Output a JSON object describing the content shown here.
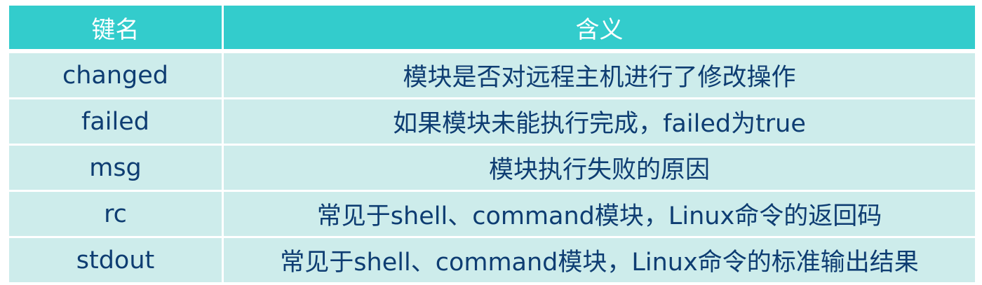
{
  "header": {
    "key_label": "键名",
    "desc_label": "含义"
  },
  "rows": [
    {
      "key": "changed",
      "desc": "模块是否对远程主机进行了修改操作"
    },
    {
      "key": "failed",
      "desc": "如果模块未能执行完成，failed为true"
    },
    {
      "key": "msg",
      "desc": "模块执行失败的原因"
    },
    {
      "key": "rc",
      "desc": "常见于shell、command模块，Linux命令的返回码"
    },
    {
      "key": "stdout",
      "desc": "常见于shell、command模块，Linux命令的标准输出结果"
    }
  ],
  "colors": {
    "header_bg": "#33cccc",
    "row_bg": "#cdeceb",
    "text": "#0e3d72",
    "header_text": "#ffffff"
  }
}
